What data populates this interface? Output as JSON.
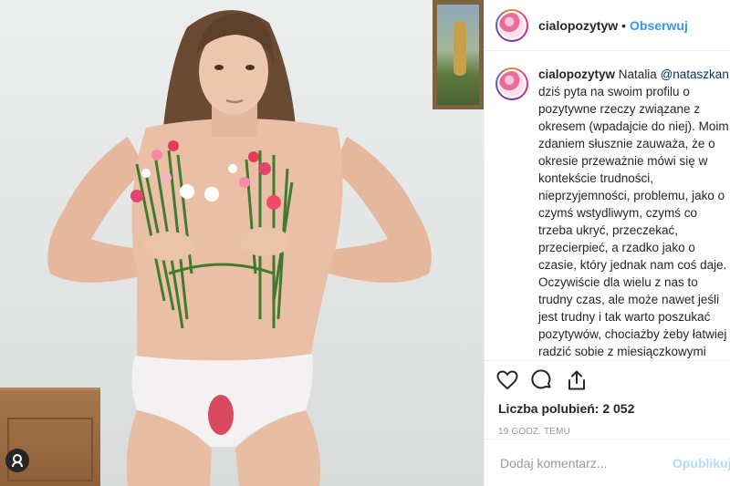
{
  "post": {
    "username": "cialopozytyw",
    "separator": "•",
    "follow_label": "Obserwuj"
  },
  "caption": {
    "username": "cialopozytyw",
    "lead": "Natalia ",
    "mention": "@nataszkan",
    "body": "dziś pyta na swoim profilu o pozytywne rzeczy związane z okresem (wpadajcie do niej). Moim zdaniem słusznie zauważa, że o okresie przeważnie mówi się w kontekście trudności, nieprzyjemności, problemu, jako o czymś wstydliwym, czymś co trzeba ukryć, przeczekać, przecierpieć, a rzadko jako o czasie, który jednak nam coś daje.\nOczywiście dla wielu z nas to trudny czas, ale może nawet jeśli jest trudny i tak warto poszukać pozytywów, chociażby żeby łatwiej radzić sobie z miesiączkowymi trudnościami.\n\nU Natalii na profilu w komentarzach pod zdjęciem z tej serii znajdziecie"
  },
  "actions": {
    "like_icon": "heart-icon",
    "comment_icon": "comment-icon",
    "share_icon": "share-icon",
    "likes_text": "Liczba polubień: 2 052",
    "time_text": "19 GODZ. TEMU"
  },
  "comment": {
    "placeholder": "Dodaj komentarz...",
    "publish_label": "Opublikuj"
  },
  "photo": {
    "user_tag_icon": "user-tag-icon"
  },
  "colors": {
    "link": "#3897f0",
    "text": "#262626",
    "muted": "#999999",
    "publish_disabled": "#b3dbff"
  }
}
